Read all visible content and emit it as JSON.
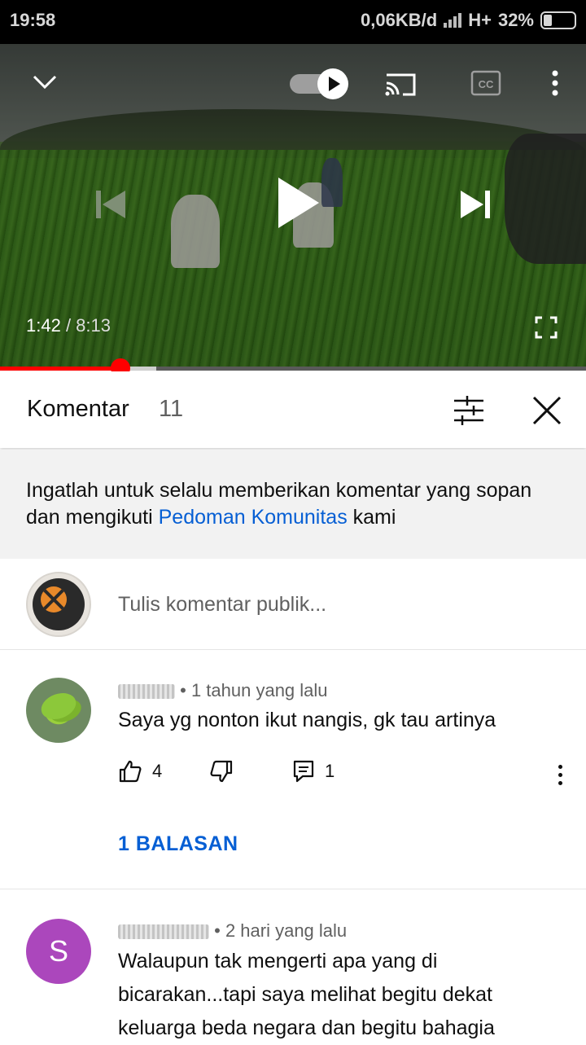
{
  "status_bar": {
    "time": "19:58",
    "network_speed": "0,06KB/d",
    "network_type": "H+",
    "battery": "32%"
  },
  "player": {
    "current_time": "1:42",
    "separator": " / ",
    "duration": "8:13",
    "progress_fraction": 0.205,
    "buffer_fraction": 0.267,
    "autoplay_on": true
  },
  "comments_panel": {
    "title": "Komentar",
    "count": "11"
  },
  "notice": {
    "text_before": "Ingatlah untuk selalu memberikan komentar yang sopan dan mengikuti ",
    "link": "Pedoman Komunitas",
    "text_after": " kami"
  },
  "compose": {
    "placeholder": "Tulis komentar publik..."
  },
  "comments": [
    {
      "time_ago": "• 1 tahun yang lalu",
      "text": "Saya yg nonton ikut nangis, gk tau artinya",
      "likes": "4",
      "reply_count": "1",
      "replies_label": "1 BALASAN"
    },
    {
      "avatar_letter": "S",
      "time_ago": "• 2 hari yang lalu",
      "text": "Walaupun tak mengerti apa yang di bicarakan...tapi saya melihat begitu dekat keluarga beda negara dan begitu bahagia"
    }
  ],
  "colors": {
    "accent_red": "#ff0000",
    "link_blue": "#065fd4",
    "avatar_purple": "#ab47bc"
  }
}
